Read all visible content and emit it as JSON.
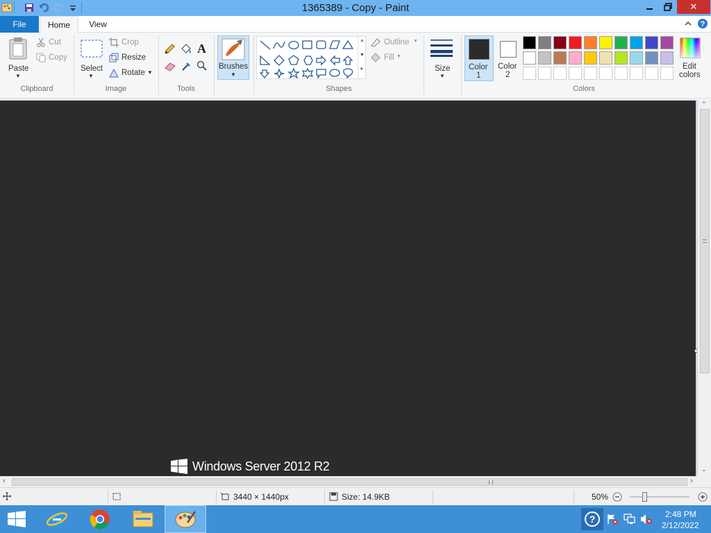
{
  "window": {
    "title": "1365389 - Copy - Paint",
    "minimize_label": "–",
    "restore_label": "❐",
    "close_label": "✕"
  },
  "tabs": {
    "file": "File",
    "home": "Home",
    "view": "View"
  },
  "ribbon": {
    "clipboard": {
      "paste": "Paste",
      "cut": "Cut",
      "copy": "Copy",
      "label": "Clipboard"
    },
    "image": {
      "select": "Select",
      "crop": "Crop",
      "resize": "Resize",
      "rotate": "Rotate",
      "label": "Image"
    },
    "tools": {
      "label": "Tools"
    },
    "brushes": {
      "label": "Brushes"
    },
    "shapes": {
      "outline": "Outline",
      "fill": "Fill",
      "label": "Shapes"
    },
    "size": {
      "label": "Size"
    },
    "color1": {
      "line1": "Color",
      "line2": "1",
      "value": "#2b2b2b"
    },
    "color2": {
      "line1": "Color",
      "line2": "2",
      "value": "#ffffff"
    },
    "colors": {
      "label": "Colors",
      "row1": [
        "#000000",
        "#7f7f7f",
        "#880015",
        "#ed1c24",
        "#ff7f27",
        "#fff200",
        "#22b14c",
        "#00a2e8",
        "#3f48cc",
        "#a349a4"
      ],
      "row2": [
        "#ffffff",
        "#c3c3c3",
        "#b97a57",
        "#ffaec9",
        "#ffc90e",
        "#efe4b0",
        "#b5e61d",
        "#99d9ea",
        "#7092be",
        "#c8bfe7"
      ]
    },
    "edit_colors": {
      "line1": "Edit",
      "line2": "colors"
    }
  },
  "canvas": {
    "background": "#2b2b2b",
    "watermark_text": "Windows Server 2012 R2"
  },
  "status": {
    "dimensions": "3440 × 1440px",
    "size": "Size: 14.9KB",
    "zoom": "50%",
    "zoom_level": 0.5
  },
  "taskbar": {
    "time": "2:48 PM",
    "date": "2/12/2022",
    "help_label": "?"
  }
}
